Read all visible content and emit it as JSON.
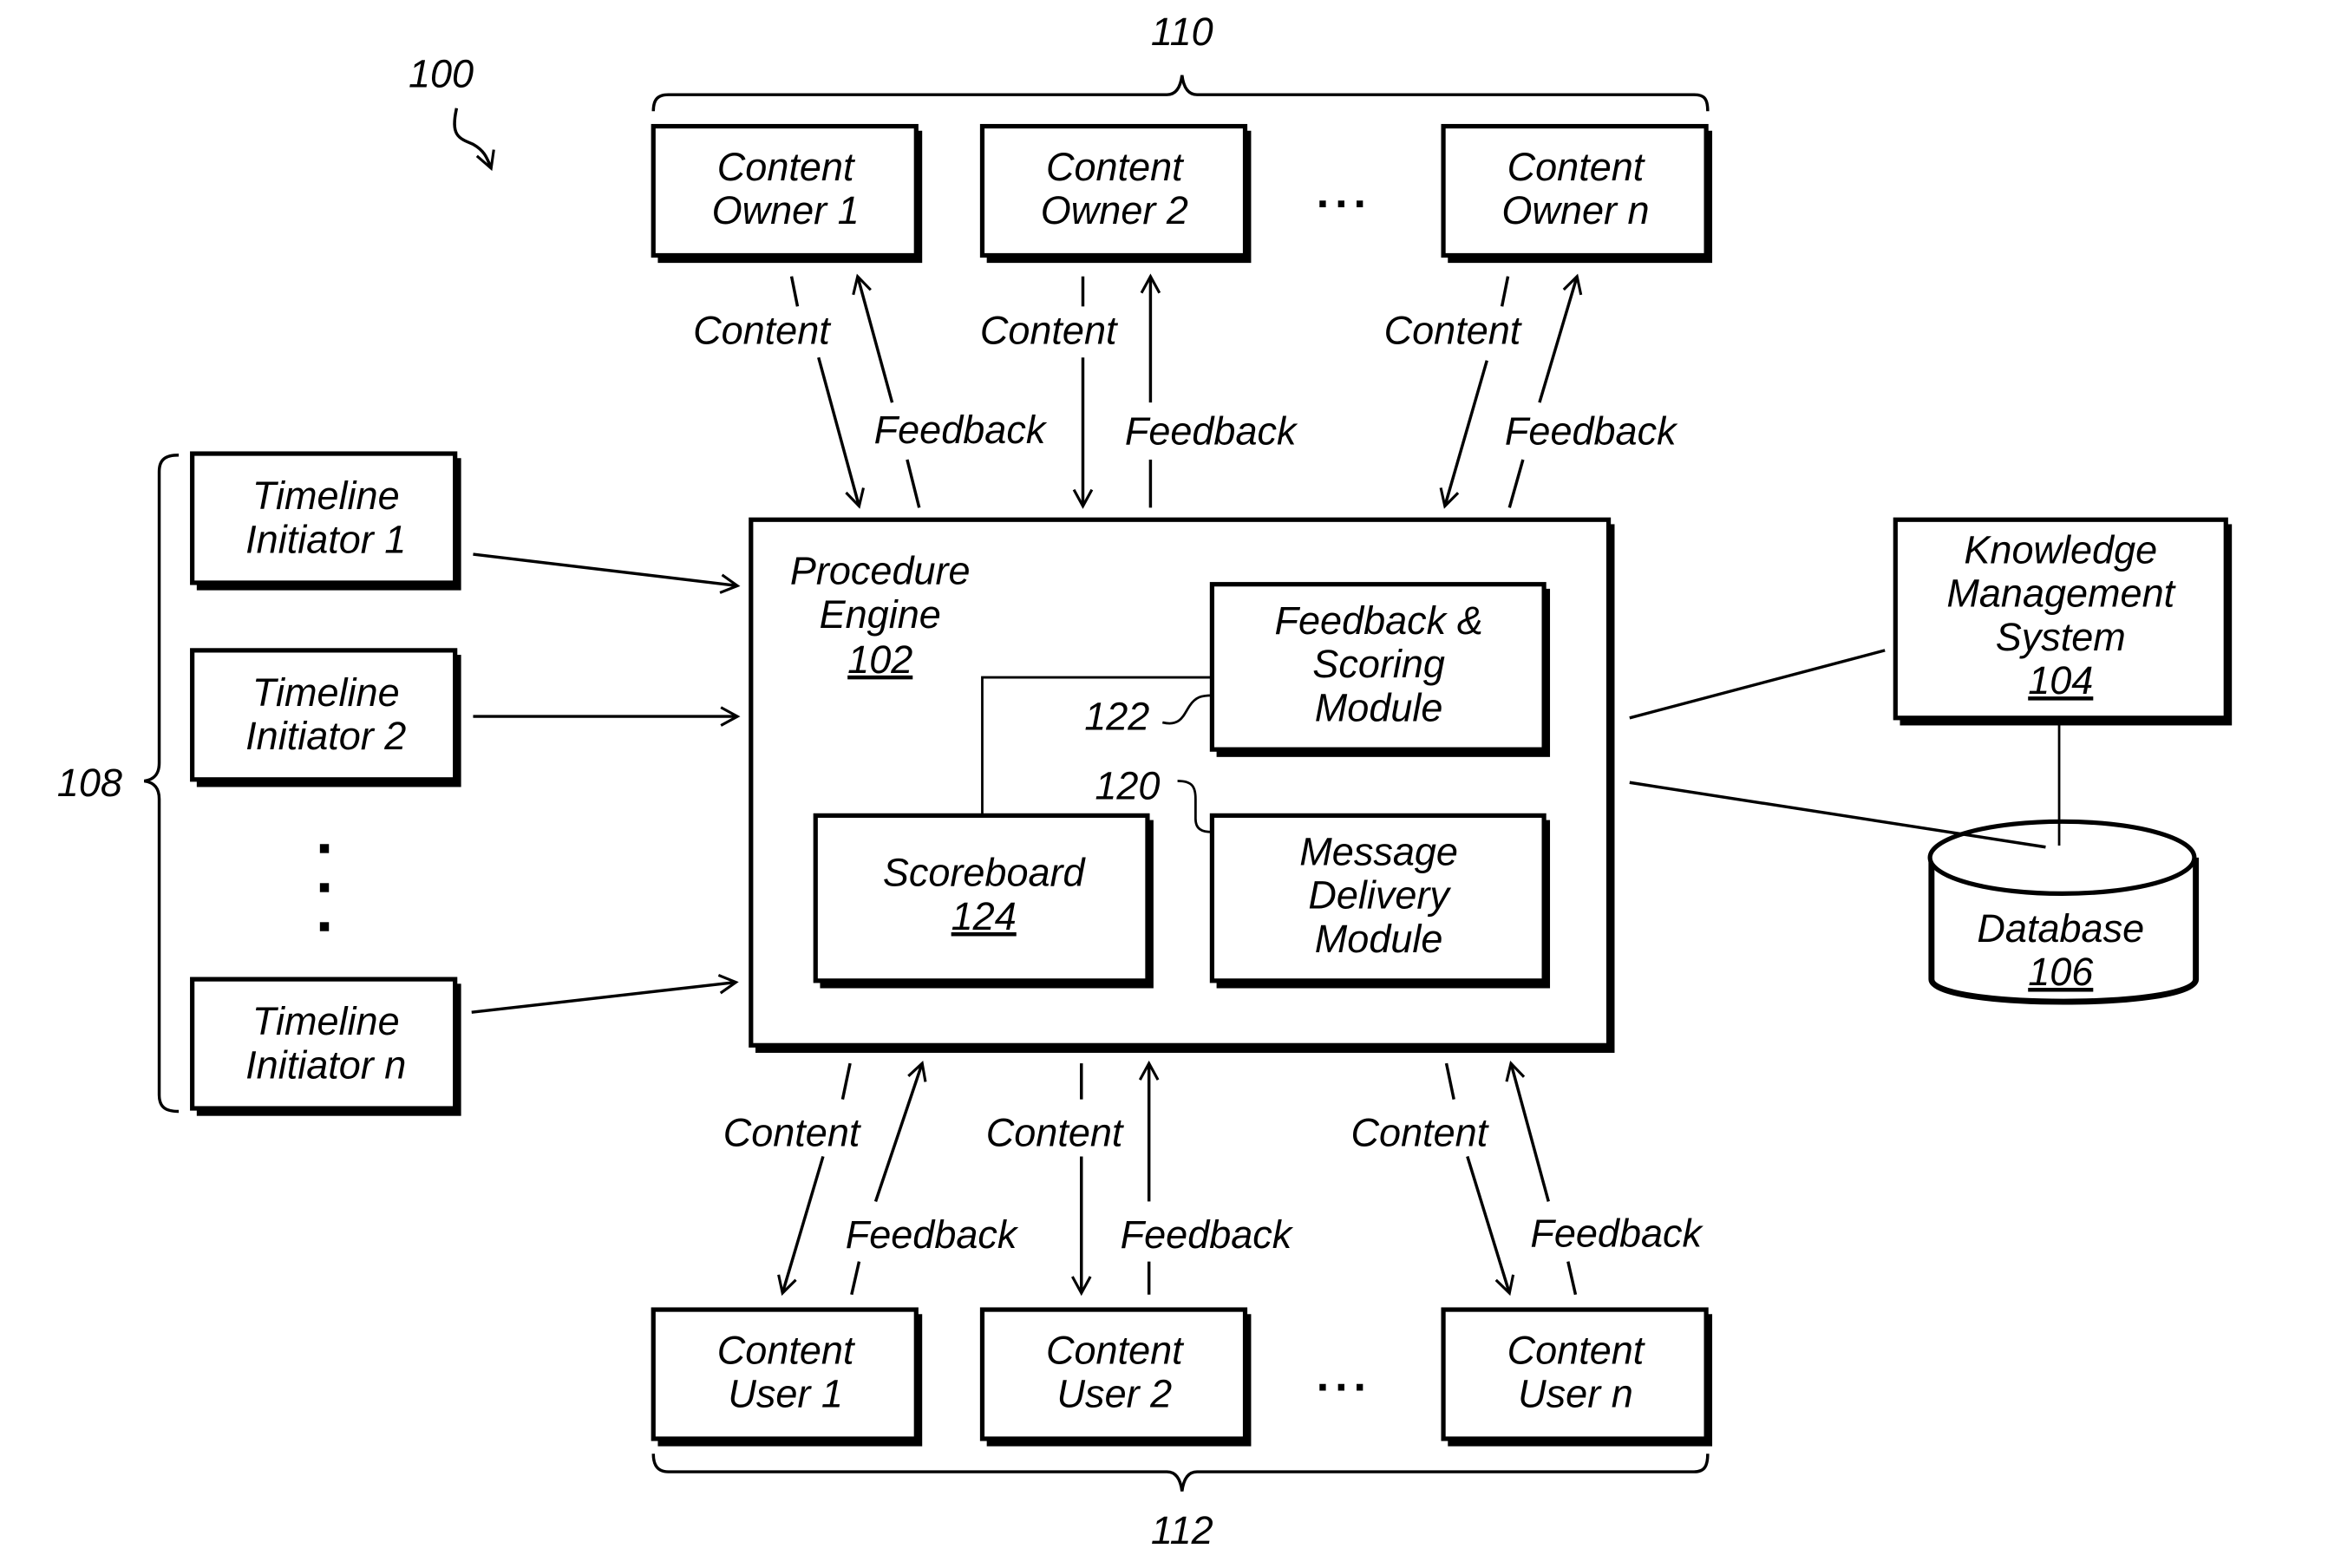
{
  "figure": {
    "ref": "100",
    "content_owners_group_ref": "110",
    "content_users_group_ref": "112",
    "timeline_initiators_group_ref": "108"
  },
  "content_owners": [
    {
      "line1": "Content",
      "line2": "Owner 1"
    },
    {
      "line1": "Content",
      "line2": "Owner 2"
    },
    {
      "line1": "Content",
      "line2": "Owner n"
    }
  ],
  "content_users": [
    {
      "line1": "Content",
      "line2": "User 1"
    },
    {
      "line1": "Content",
      "line2": "User 2"
    },
    {
      "line1": "Content",
      "line2": "User n"
    }
  ],
  "timeline_initiators": [
    {
      "line1": "Timeline",
      "line2": "Initiator 1"
    },
    {
      "line1": "Timeline",
      "line2": "Initiator 2"
    },
    {
      "line1": "Timeline",
      "line2": "Initiator n"
    }
  ],
  "ellipsis": "...",
  "flow_labels": {
    "content": "Content",
    "feedback": "Feedback"
  },
  "procedure_engine": {
    "line1": "Procedure",
    "line2": "Engine",
    "ref": "102"
  },
  "feedback_scoring_module": {
    "line1": "Feedback &",
    "line2": "Scoring",
    "line3": "Module",
    "ref": "122"
  },
  "message_delivery_module": {
    "line1": "Message",
    "line2": "Delivery",
    "line3": "Module",
    "ref": "120"
  },
  "scoreboard": {
    "line1": "Scoreboard",
    "ref": "124"
  },
  "knowledge_management_system": {
    "line1": "Knowledge",
    "line2": "Management",
    "line3": "System",
    "ref": "104"
  },
  "database": {
    "line1": "Database",
    "ref": "106"
  }
}
